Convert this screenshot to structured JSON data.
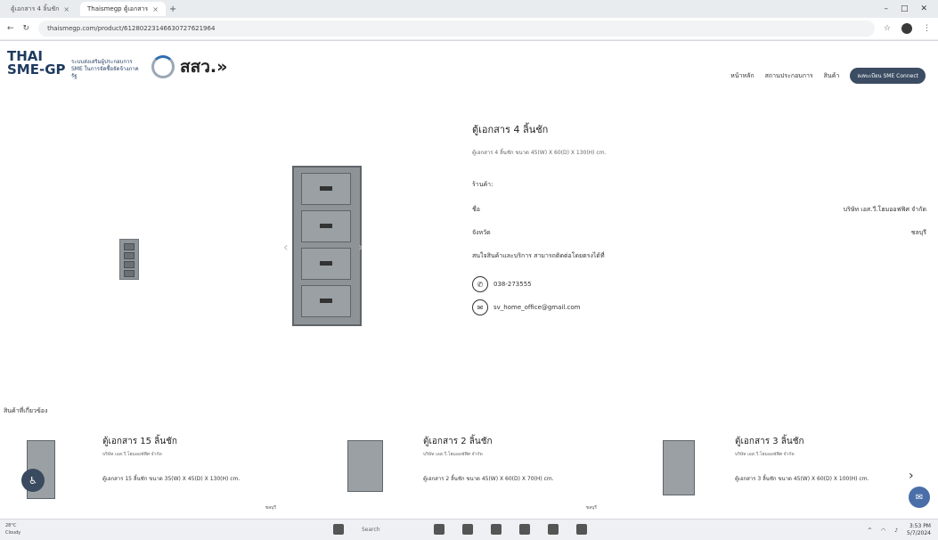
{
  "browser": {
    "tabs": [
      {
        "label": "ตู้เอกสาร 4 ลิ้นชัก",
        "active": false
      },
      {
        "label": "Thaismegp ตู้เอกสาร",
        "active": true
      }
    ],
    "url": "thaismegp.com/product/61280223146630727621964",
    "icons": [
      "back-icon",
      "reload-icon",
      "star-icon",
      "profile-icon",
      "menu-icon"
    ]
  },
  "header": {
    "logo_line1": "THAI",
    "logo_line2": "SME-GP",
    "logo_sub": "ระบบส่งเสริมผู้ประกอบการ SME ในการจัดซื้อจัดจ้างภาครัฐ",
    "agency": "สสว.»",
    "nav": [
      "หน้าหลัก",
      "สถานประกอบการ",
      "สินค้า"
    ],
    "nav_button": "ลงทะเบียน SME Connect"
  },
  "product": {
    "title": "ตู้เอกสาร 4 ลิ้นชัก",
    "description": "ตู้เอกสาร 4 ลิ้นชัก ขนาด 45(W) X 60(D) X 130(H) cm.",
    "shop_label": "ร้านค้า:",
    "name_label": "ชื่อ",
    "shop_name": "บริษัท เอส.วี.โฮมออฟฟิศ จำกัด",
    "province_label": "จังหวัด",
    "province": "ชลบุรี",
    "contact_prompt": "สนใจสินค้าและบริการ สามารถติดต่อโดยตรงได้ที่",
    "phone": "038-273555",
    "email": "sv_home_office@gmail.com"
  },
  "related": {
    "section_title": "สินค้าที่เกี่ยวข้อง",
    "items": [
      {
        "title": "ตู้เอกสาร 15 ลิ้นชัก",
        "shop": "บริษัท เอส.วี.โฮมออฟฟิศ จำกัด",
        "desc": "ตู้เอกสาร 15 ลิ้นชัก ขนาด 35(W) X 45(D) X 130(H) cm.",
        "province": "ชลบุรี"
      },
      {
        "title": "ตู้เอกสาร 2 ลิ้นชัก",
        "shop": "บริษัท เอส.วี.โฮมออฟฟิศ จำกัด",
        "desc": "ตู้เอกสาร 2 ลิ้นชัก ขนาด 45(W) X 60(D) X 70(H) cm.",
        "province": "ชลบุรี"
      },
      {
        "title": "ตู้เอกสาร 3 ลิ้นชัก",
        "shop": "บริษัท เอส.วี.โฮมออฟฟิศ จำกัด",
        "desc": "ตู้เอกสาร 3 ลิ้นชัก ขนาด 45(W) X 60(D) X 100(H) cm.",
        "province": ""
      }
    ]
  },
  "taskbar": {
    "weather_temp": "28°C",
    "weather_text": "Cloudy",
    "search_label": "Search",
    "clock_time": "3:53 PM",
    "clock_date": "5/7/2024"
  }
}
